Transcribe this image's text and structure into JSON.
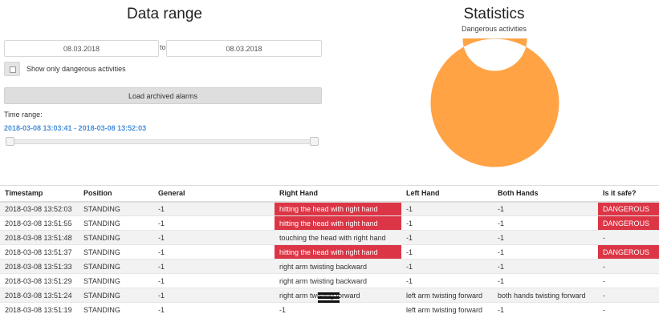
{
  "data_range": {
    "title": "Data range",
    "date_from": "08.03.2018",
    "to_label": "to",
    "date_to": "08.03.2018",
    "dangerous_only_label": "Show only dangerous activities",
    "load_button": "Load archived alarms",
    "time_range_label": "Time range:",
    "time_range_value": "2018-03-08 13:03:41 - 2018-03-08 13:52:03",
    "slider": {
      "start_fraction": 0.0,
      "end_fraction": 1.0
    }
  },
  "statistics": {
    "title": "Statistics",
    "subtitle": "Dangerous activities"
  },
  "chart_data": {
    "type": "pie",
    "donut": true,
    "title": "Dangerous activities",
    "slices": [
      {
        "value": 100,
        "color": "#ffa345"
      }
    ]
  },
  "table": {
    "columns": [
      "Timestamp",
      "Position",
      "General",
      "Right Hand",
      "Left Hand",
      "Both Hands",
      "Is it safe?"
    ],
    "rows": [
      [
        "2018-03-08 13:52:03",
        "STANDING",
        "-1",
        "hitting the head with right hand",
        "-1",
        "-1",
        "DANGEROUS"
      ],
      [
        "2018-03-08 13:51:55",
        "STANDING",
        "-1",
        "hitting the head with right hand",
        "-1",
        "-1",
        "DANGEROUS"
      ],
      [
        "2018-03-08 13:51:48",
        "STANDING",
        "-1",
        "touching the head with right hand",
        "-1",
        "-1",
        "-"
      ],
      [
        "2018-03-08 13:51:37",
        "STANDING",
        "-1",
        "hitting the head with right hand",
        "-1",
        "-1",
        "DANGEROUS"
      ],
      [
        "2018-03-08 13:51:33",
        "STANDING",
        "-1",
        "right arm twisting backward",
        "-1",
        "-1",
        "-"
      ],
      [
        "2018-03-08 13:51:29",
        "STANDING",
        "-1",
        "right arm twisting backward",
        "-1",
        "-1",
        "-"
      ],
      [
        "2018-03-08 13:51:24",
        "STANDING",
        "-1",
        "right arm twisting forward",
        "left arm twisting forward",
        "both hands twisting forward",
        "-"
      ],
      [
        "2018-03-08 13:51:19",
        "STANDING",
        "-1",
        "-1",
        "left arm twisting forward",
        "-1",
        "-"
      ]
    ],
    "danger_color": "#dc3545",
    "drag_handle_icon": "hamburger-icon"
  }
}
